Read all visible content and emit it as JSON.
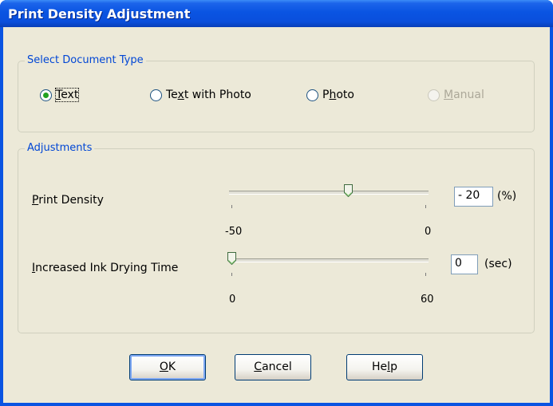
{
  "window": {
    "title": "Print Density Adjustment"
  },
  "document_type": {
    "legend": "Select Document Type",
    "options": [
      {
        "pre": "",
        "u": "T",
        "post": "ext",
        "selected": true,
        "disabled": false
      },
      {
        "pre": "Te",
        "u": "x",
        "post": "t with Photo",
        "selected": false,
        "disabled": false
      },
      {
        "pre": "P",
        "u": "h",
        "post": "oto",
        "selected": false,
        "disabled": false
      },
      {
        "pre": "",
        "u": "M",
        "post": "anual",
        "selected": false,
        "disabled": true
      }
    ]
  },
  "adjustments": {
    "legend": "Adjustments",
    "print_density": {
      "label_u": "P",
      "label_rest": "rint Density",
      "min_label": "-50",
      "max_label": "0",
      "min": -50,
      "max": 0,
      "value": -20,
      "display_value": "- 20",
      "unit": "(%)"
    },
    "drying_time": {
      "label_u": "I",
      "label_rest": "ncreased Ink Drying Time",
      "min_label": "0",
      "max_label": "60",
      "min": 0,
      "max": 60,
      "value": 0,
      "display_value": "0",
      "unit": "(sec)"
    }
  },
  "buttons": {
    "ok": {
      "u": "O",
      "rest": "K"
    },
    "cancel": {
      "u": "C",
      "rest": "ancel"
    },
    "help": {
      "pre": "He",
      "u": "l",
      "rest": "p"
    }
  },
  "colors": {
    "title_bar": "#0a54e2",
    "group_legend": "#0046d5",
    "radio_dot": "#21a121"
  }
}
